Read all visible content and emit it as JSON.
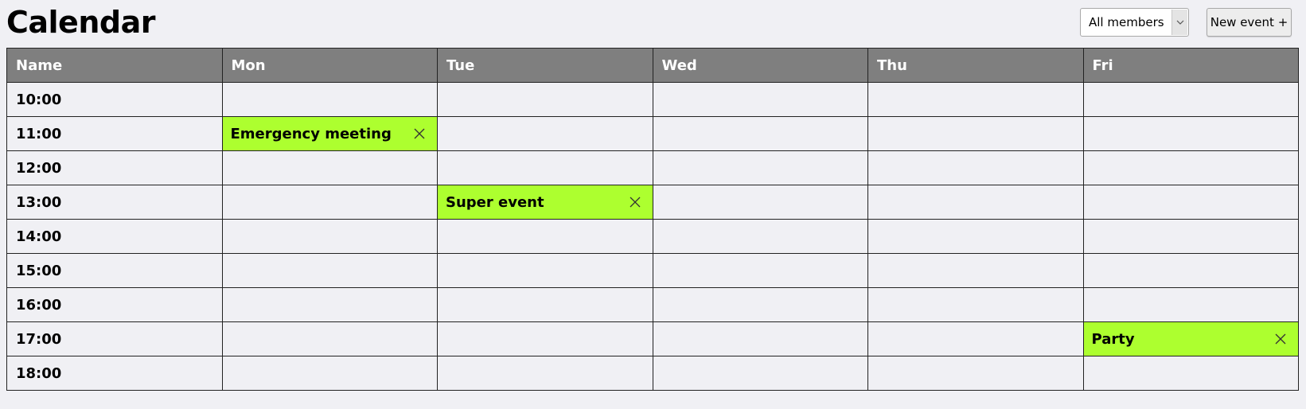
{
  "page": {
    "title": "Calendar"
  },
  "controls": {
    "member_filter": {
      "selected": "All members"
    },
    "new_event_label": "New event +"
  },
  "table": {
    "headers": [
      "Name",
      "Mon",
      "Tue",
      "Wed",
      "Thu",
      "Fri"
    ],
    "times": [
      "10:00",
      "11:00",
      "12:00",
      "13:00",
      "14:00",
      "15:00",
      "16:00",
      "17:00",
      "18:00"
    ]
  },
  "events": [
    {
      "title": "Emergency meeting",
      "day": "Mon",
      "time": "11:00"
    },
    {
      "title": "Super event",
      "day": "Tue",
      "time": "13:00"
    },
    {
      "title": "Party",
      "day": "Fri",
      "time": "17:00"
    }
  ],
  "colors": {
    "event_background": "#adff2f",
    "header_background": "#7f7f7f",
    "page_background": "#f0f0f4",
    "grid_border": "#222222"
  },
  "icons": {
    "select_arrow": "chevron-down-icon",
    "delete_event": "close-icon"
  }
}
